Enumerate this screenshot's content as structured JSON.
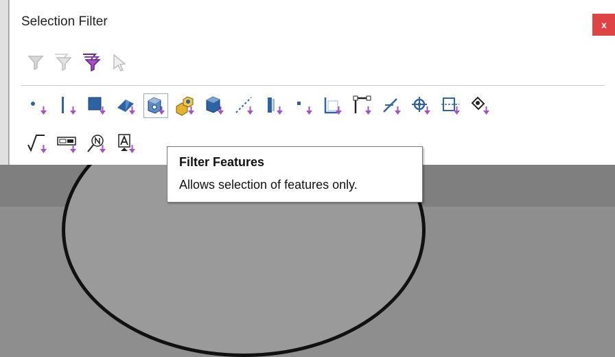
{
  "window": {
    "title": "Selection Filter",
    "close_label": "x"
  },
  "colors": {
    "accent": "#a64fc9",
    "close": "#e04343",
    "blue": "#2d63a5"
  },
  "toolbar_top": [
    {
      "name": "filter-icon",
      "enabled": false
    },
    {
      "name": "filter-multiple-icon",
      "enabled": false
    },
    {
      "name": "filter-active-icon",
      "enabled": true
    },
    {
      "name": "select-pointer-icon",
      "enabled": false
    }
  ],
  "filters_row1": [
    "filter-vertices-icon",
    "filter-edges-icon",
    "filter-faces-icon",
    "filter-surface-bodies-icon",
    "filter-features-icon",
    "filter-solid-bodies-icon",
    "filter-components-icon",
    "filter-axes-icon",
    "filter-planes-icon",
    "filter-sketch-points-icon",
    "filter-sketch-segments-icon",
    "filter-sketch-corner-icon",
    "filter-curves-icon",
    "filter-origin-icon",
    "filter-ref-plane-icon",
    "filter-cosmetic-icon"
  ],
  "filters_row2": [
    "filter-surface-finish-icon",
    "filter-dimensions-icon",
    "filter-notes-icon",
    "filter-datum-icon",
    "filter-gtol-icon",
    "filter-blocks-icon",
    "filter-cosmetic-thread-icon",
    "filter-balloons-icon",
    "filter-center-marks-icon",
    "filter-weld-symbols-icon",
    "filter-dowel-icon",
    "filter-connection-points-icon",
    "filter-mesh-icon",
    "filter-mesh-facet-icon",
    "filter-mesh-vertex-icon"
  ],
  "tooltip": {
    "title": "Filter Features",
    "body": "Allows selection of features only."
  }
}
